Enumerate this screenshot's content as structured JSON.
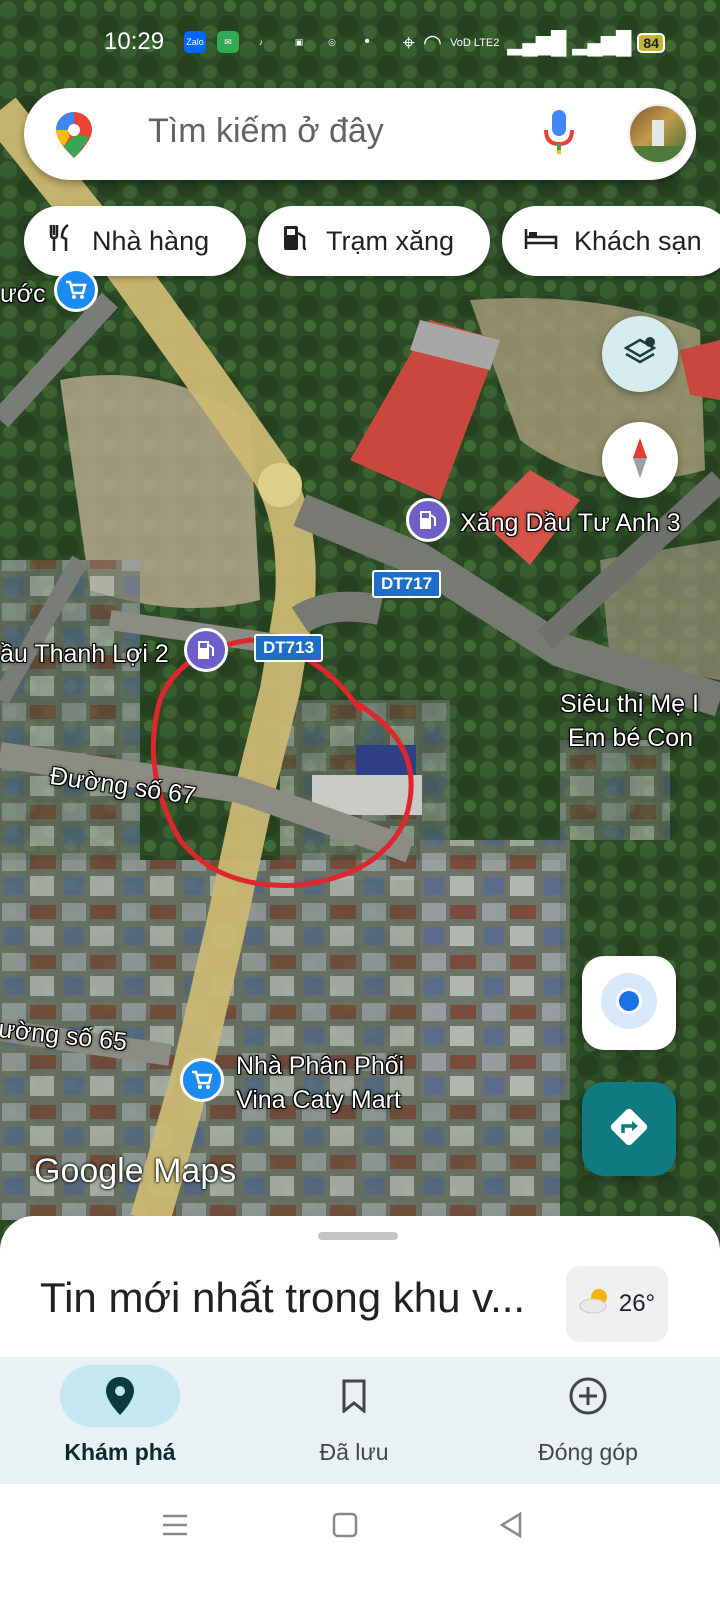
{
  "status_bar": {
    "time": "10:29",
    "apps": [
      "Zalo",
      "chat",
      "tiktok",
      "shop",
      "chrome"
    ],
    "network": "VoD LTE2",
    "battery": "84"
  },
  "search": {
    "placeholder": "Tìm kiếm ở đây",
    "icons": [
      "maps-pin-logo",
      "mic-icon",
      "avatar"
    ]
  },
  "chips": [
    {
      "label": "Nhà hàng",
      "icon": "fork-knife-icon"
    },
    {
      "label": "Trạm xăng",
      "icon": "gas-pump-icon"
    },
    {
      "label": "Khách sạn",
      "icon": "bed-icon"
    }
  ],
  "map_labels": {
    "xang_dau": "Xăng Dầu Tư Anh 3",
    "thanh_loi": "ầu Thanh Lợi 2",
    "sieu_thi_line1": "Siêu thị Mẹ I",
    "sieu_thi_line2": "Em bé Con",
    "duong_67": "Đường số 67",
    "duong_65": "ường số 65",
    "nha_phan_phoi_line1": "Nhà Phân Phối",
    "nha_phan_phoi_line2": "Vina Caty Mart",
    "uoc": "ước",
    "route_dt717": "DT717",
    "route_dt713": "DT713"
  },
  "google_maps_logo": "Google Maps",
  "sheet": {
    "title": "Tin mới nhất trong khu v...",
    "temperature": "26°"
  },
  "bottom_nav": [
    {
      "label": "Khám phá",
      "icon": "explore-pin-icon",
      "active": true
    },
    {
      "label": "Đã lưu",
      "icon": "bookmark-icon",
      "active": false
    },
    {
      "label": "Đóng góp",
      "icon": "add-circle-icon",
      "active": false
    }
  ],
  "colors": {
    "accent_teal": "#0f7a80",
    "active_tab_bg": "#c4e7f0",
    "location_blue": "#1a73e8",
    "annotation_red": "#e0262d"
  }
}
